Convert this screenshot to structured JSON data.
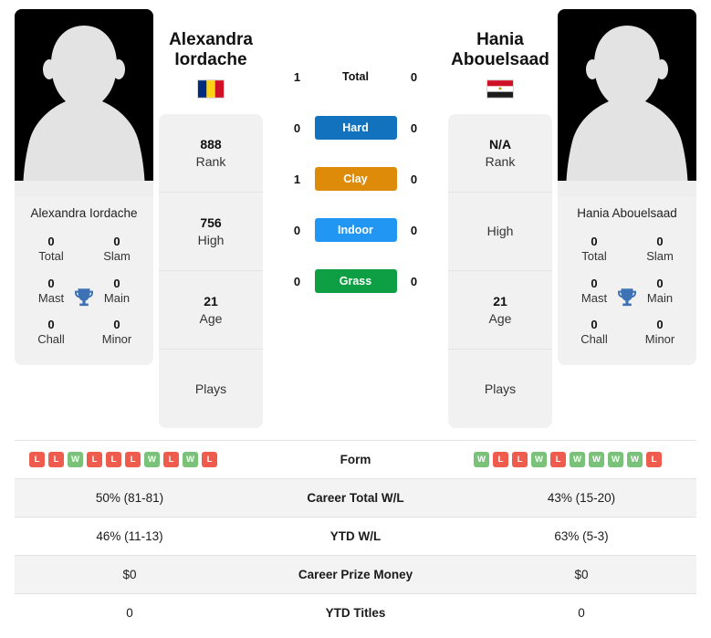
{
  "players": {
    "left": {
      "name_line1": "Alexandra",
      "name_line2": "Iordache",
      "full_name": "Alexandra Iordache",
      "card_name": "Alexandra Iordache",
      "country": "Romania",
      "flag_icon": "flag-romania",
      "photo_alt": "player-photo-placeholder",
      "titles": [
        {
          "value": "0",
          "label": "Total"
        },
        {
          "value": "0",
          "label": "Slam"
        },
        {
          "value": "0",
          "label": "Mast"
        },
        {
          "value": "0",
          "label": "Main"
        },
        {
          "value": "0",
          "label": "Chall"
        },
        {
          "value": "0",
          "label": "Minor"
        }
      ],
      "info": [
        {
          "value": "888",
          "label": "Rank"
        },
        {
          "value": "756",
          "label": "High"
        },
        {
          "value": "21",
          "label": "Age"
        },
        {
          "value": "",
          "label": "Plays"
        }
      ]
    },
    "right": {
      "name_line1": "Hania",
      "name_line2": "Abouelsaad",
      "full_name": "Hania Abouelsaad",
      "card_name": "Hania Abouelsaad",
      "country": "Egypt",
      "flag_icon": "flag-egypt",
      "photo_alt": "player-photo-placeholder",
      "titles": [
        {
          "value": "0",
          "label": "Total"
        },
        {
          "value": "0",
          "label": "Slam"
        },
        {
          "value": "0",
          "label": "Mast"
        },
        {
          "value": "0",
          "label": "Main"
        },
        {
          "value": "0",
          "label": "Chall"
        },
        {
          "value": "0",
          "label": "Minor"
        }
      ],
      "info": [
        {
          "value": "N/A",
          "label": "Rank"
        },
        {
          "value": "",
          "label": "High"
        },
        {
          "value": "21",
          "label": "Age"
        },
        {
          "value": "",
          "label": "Plays"
        }
      ]
    }
  },
  "head_to_head": [
    {
      "label": "Total",
      "left": "1",
      "right": "0",
      "style": "plain",
      "color": ""
    },
    {
      "label": "Hard",
      "left": "0",
      "right": "0",
      "style": "badge",
      "color": "#1272bd"
    },
    {
      "label": "Clay",
      "left": "1",
      "right": "0",
      "style": "badge",
      "color": "#df8b0a"
    },
    {
      "label": "Indoor",
      "left": "0",
      "right": "0",
      "style": "badge",
      "color": "#2196f3"
    },
    {
      "label": "Grass",
      "left": "0",
      "right": "0",
      "style": "badge",
      "color": "#0e9e43"
    }
  ],
  "stats_table": {
    "rows": [
      {
        "label": "Form",
        "type": "form",
        "left_form": [
          "L",
          "L",
          "W",
          "L",
          "L",
          "L",
          "W",
          "L",
          "W",
          "L"
        ],
        "right_form": [
          "W",
          "L",
          "L",
          "W",
          "L",
          "W",
          "W",
          "W",
          "W",
          "L"
        ],
        "shaded": false
      },
      {
        "label": "Career Total W/L",
        "type": "text",
        "left": "50% (81-81)",
        "right": "43% (15-20)",
        "shaded": true
      },
      {
        "label": "YTD W/L",
        "type": "text",
        "left": "46% (11-13)",
        "right": "63% (5-3)",
        "shaded": false
      },
      {
        "label": "Career Prize Money",
        "type": "text",
        "left": "$0",
        "right": "$0",
        "shaded": true
      },
      {
        "label": "YTD Titles",
        "type": "text",
        "left": "0",
        "right": "0",
        "shaded": false
      }
    ]
  },
  "colors": {
    "win_badge": "#7ac27a",
    "loss_badge": "#ef5b4c",
    "panel_bg": "#f1f1f1",
    "row_shade": "#f3f3f3",
    "trophy": "#3d72b4"
  }
}
